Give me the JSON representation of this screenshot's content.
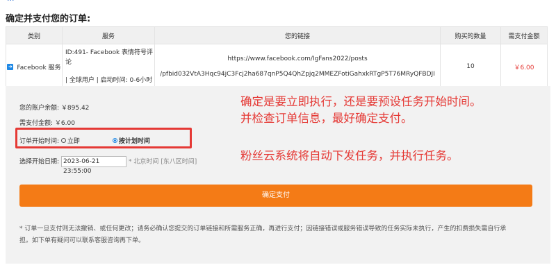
{
  "top_fragment": "···",
  "page_title": "确定并支付您的订单:",
  "table": {
    "headers": [
      "类别",
      "服务",
      "您的链接",
      "购买的数量",
      "需支付金额"
    ],
    "row": {
      "category": "Facebook 服务",
      "service_line1": "ID:491- Facebook 表情符号评论",
      "service_line2": "| 全球用户 | 启动时间: 0-6小时",
      "link_line1": "https://www.facebook.com/IgFans2022/posts",
      "link_line2": "/pfbid032VtA3Hqc94jC3Fcj2ha687qnP5Q4QhZpjq2MMEZFotiGahxkRTgP5T76MRyQFBDJI",
      "quantity": "10",
      "amount": "￥6.00"
    }
  },
  "balance_label": "您的账户余额:",
  "balance_value": "￥895.42",
  "due_label": "需支付金额:",
  "due_value": "￥6.00",
  "start_time_label": "订单开始时间:",
  "option_now": "立即",
  "option_scheduled": "按计划时间",
  "selected_option": "按计划时间",
  "start_date_label": "选择开始日期:",
  "start_date_value": "2023-06-21 23:55:00",
  "timezone_hint": "* 北京时间 [东八区时间]",
  "pay_button": "确定支付",
  "notice_line1": "* 订单一旦支付则无法撤销、或任何更改；请务必确认您提交的订单链接和所需服务正确，再进行支付；因链接错误或服务错误导致的任务实际未执行，产生的扣费损失需自行承",
  "notice_line2": "担。如下单有疑问可以联系客服咨询再下单。",
  "annotations": {
    "line1": "确定是要立即执行，还是要预设任务开始时间。",
    "line2": "并检查订单信息，最好确定支付。",
    "line3": "粉丝云系统将自动下发任务，并执行任务。"
  },
  "colors": {
    "accent": "#f47b16",
    "annotation": "#e53935",
    "price": "#e53935",
    "radio": "#1e88e5"
  }
}
